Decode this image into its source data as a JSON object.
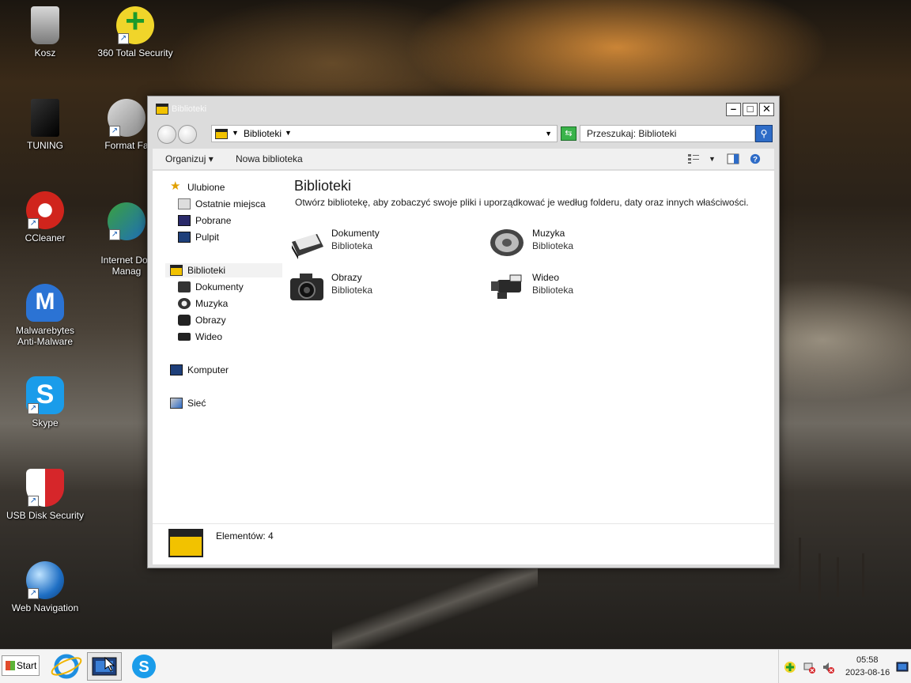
{
  "desktop": {
    "icons": [
      {
        "label": "Kosz"
      },
      {
        "label": "360 Total Security"
      },
      {
        "label": "TUNING"
      },
      {
        "label": "Format Fa"
      },
      {
        "label": "CCleaner"
      },
      {
        "label": "Internet Dov\nManag"
      },
      {
        "label": "Malwarebytes Anti-Malware"
      },
      {
        "label": "Skype"
      },
      {
        "label": "USB Disk Security"
      },
      {
        "label": "Web Navigation"
      }
    ]
  },
  "window": {
    "title": "Biblioteki",
    "address": {
      "crumb": "Biblioteki"
    },
    "search_placeholder": "Przeszukaj: Biblioteki",
    "toolbar": {
      "organize": "Organizuj",
      "new_library": "Nowa biblioteka"
    },
    "nav": {
      "favorites": "Ulubione",
      "favorites_items": [
        "Ostatnie miejsca",
        "Pobrane",
        "Pulpit"
      ],
      "libraries": "Biblioteki",
      "libraries_items": [
        "Dokumenty",
        "Muzyka",
        "Obrazy",
        "Wideo"
      ],
      "computer": "Komputer",
      "network": "Sieć"
    },
    "main": {
      "heading": "Biblioteki",
      "description": "Otwórz bibliotekę, aby zobaczyć swoje pliki i uporządkować je według folderu, daty oraz innych właściwości.",
      "libraries": [
        {
          "name": "Dokumenty",
          "type": "Biblioteka"
        },
        {
          "name": "Muzyka",
          "type": "Biblioteka"
        },
        {
          "name": "Obrazy",
          "type": "Biblioteka"
        },
        {
          "name": "Wideo",
          "type": "Biblioteka"
        }
      ]
    },
    "status": "Elementów: 4"
  },
  "taskbar": {
    "start": "Start",
    "clock_time": "05:58",
    "clock_date": "2023-08-16"
  }
}
